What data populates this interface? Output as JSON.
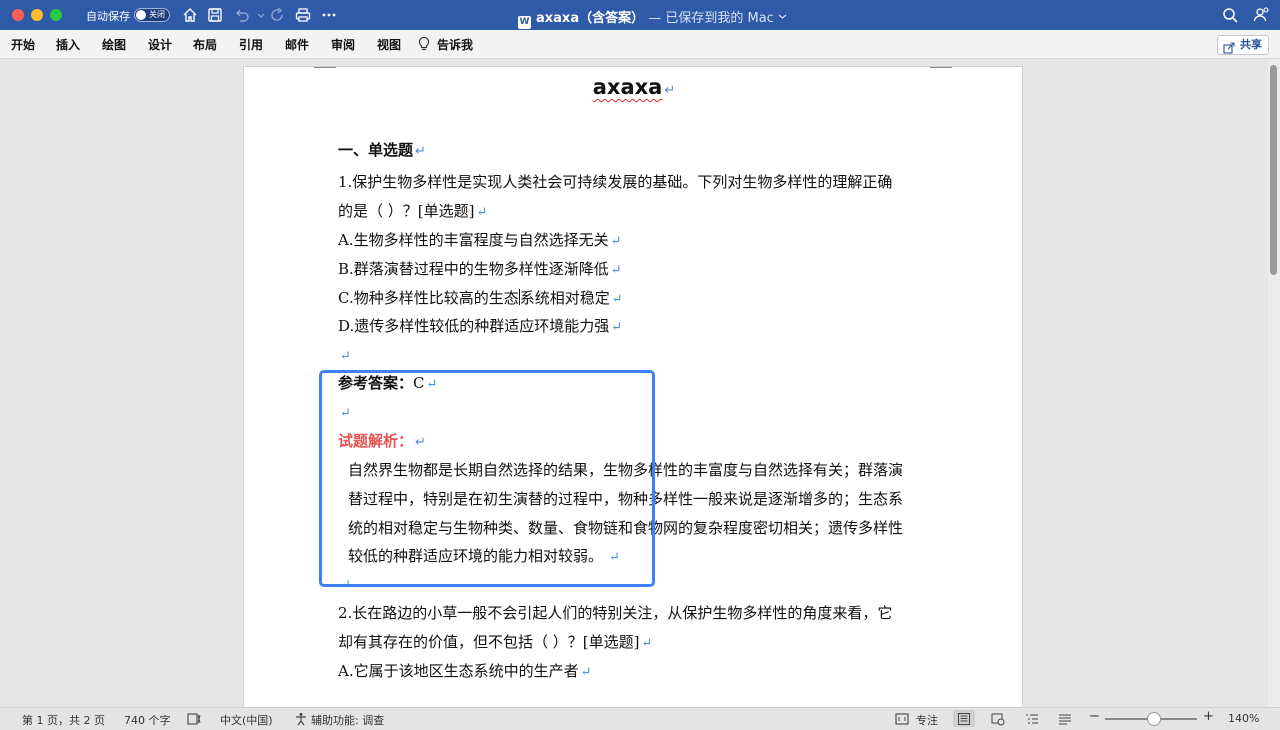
{
  "titlebar": {
    "autosave_label": "自动保存",
    "autosave_state": "关闭",
    "doc_name": "axaxa（含答案）",
    "saved_status": "— 已保存到我的 Mac",
    "word_badge": "W",
    "icons": [
      "home-icon",
      "save-icon",
      "undo-icon",
      "redo-icon",
      "print-icon",
      "more-icon",
      "search-icon",
      "account-icon"
    ]
  },
  "ribbon": {
    "tabs": [
      "开始",
      "插入",
      "绘图",
      "设计",
      "布局",
      "引用",
      "邮件",
      "审阅",
      "视图"
    ],
    "tell_me": "告诉我",
    "share": "共享"
  },
  "document": {
    "title": "axaxa",
    "section1": "一、单选题",
    "q1_line1": "1.保护生物多样性是实现人类社会可持续发展的基础。下列对生物多样性的理解正确",
    "q1_line2": "的是（  ）？[单选题]",
    "q1_a": "A.生物多样性的丰富程度与自然选择无关",
    "q1_b": "B.群落演替过程中的生物多样性逐渐降低",
    "q1_c_before": "C.物种多样性比较高的生态",
    "q1_c_after": "系统相对稳定",
    "q1_d": "D.遗传多样性较低的种群适应环境能力强",
    "answer_label": "参考答案：",
    "answer_value": "C",
    "analysis_label": "试题解析：",
    "analysis_l1": "自然界生物都是长期自然选择的结果，生物多样性的丰富度与自然选择有关；群落演",
    "analysis_l2": "替过程中，特别是在初生演替的过程中，物种多样性一般来说是逐渐增多的；生态系",
    "analysis_l3": "统的相对稳定与生物种类、数量、食物链和食物网的复杂程度密切相关；遗传多样性",
    "analysis_l4": "较低的种群适应环境的能力相对较弱。",
    "q2_line1": "2.长在路边的小草一般不会引起人们的特别关注，从保护生物多样性的角度来看，它",
    "q2_line2": "却有其存在的价值，但不包括（  ）？[单选题]",
    "q2_a": "A.它属于该地区生态系统中的生产者",
    "para_mark": "↵"
  },
  "statusbar": {
    "page": "第 1 页，共 2 页",
    "words": "740 个字",
    "language": "中文(中国)",
    "accessibility": "辅助功能: 调查",
    "focus": "专注",
    "zoom_level": "140%",
    "zoom_minus": "−",
    "zoom_plus": "+"
  }
}
